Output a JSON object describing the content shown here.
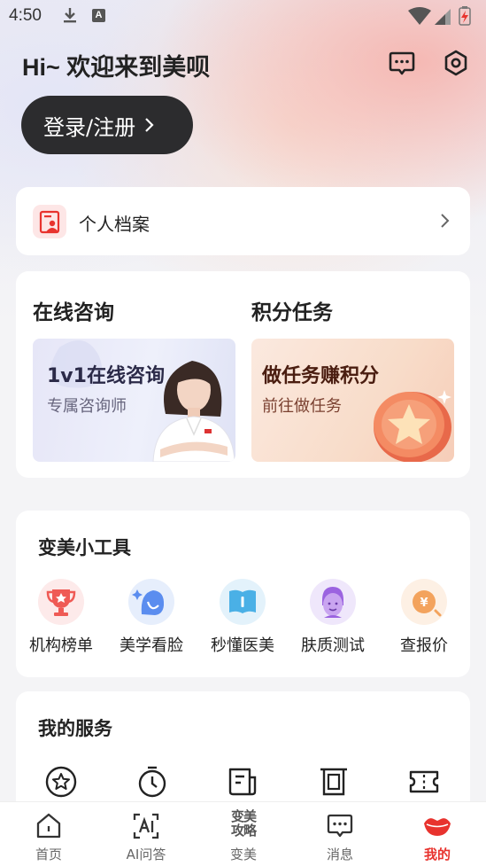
{
  "status_bar": {
    "time": "4:50",
    "app_badge": "A"
  },
  "header": {
    "greeting": "Hi~ 欢迎来到美呗",
    "login_label": "登录/注册"
  },
  "profile": {
    "label": "个人档案"
  },
  "consult": {
    "title": "在线咨询",
    "banner_title": "1v1在线咨询",
    "banner_subtitle": "专属咨询师"
  },
  "tasks": {
    "title": "积分任务",
    "banner_title": "做任务赚积分",
    "banner_subtitle": "前往做任务"
  },
  "tools": {
    "title": "变美小工具",
    "items": [
      {
        "label": "机构榜单",
        "icon": "trophy-icon"
      },
      {
        "label": "美学看脸",
        "icon": "face-scan-icon"
      },
      {
        "label": "秒懂医美",
        "icon": "book-icon"
      },
      {
        "label": "肤质测试",
        "icon": "skin-test-icon"
      },
      {
        "label": "查报价",
        "icon": "price-icon"
      }
    ]
  },
  "services": {
    "title": "我的服务",
    "icons": [
      "star-icon",
      "timer-icon",
      "document-icon",
      "print-icon",
      "ticket-icon"
    ]
  },
  "tabbar": {
    "active": "我的",
    "items": [
      {
        "label": "首页",
        "icon": "home-icon"
      },
      {
        "label": "AI问答",
        "icon": "ai-icon"
      },
      {
        "label": "变美",
        "icon": "beauty-guide-icon",
        "icon_text": "变美攻略"
      },
      {
        "label": "消息",
        "icon": "message-icon"
      },
      {
        "label": "我的",
        "icon": "lips-icon"
      }
    ]
  },
  "colors": {
    "accent": "#e8332e",
    "login_button": "#2c2c2e",
    "card": "#ffffff",
    "page_bg": "#f4f4f6"
  }
}
